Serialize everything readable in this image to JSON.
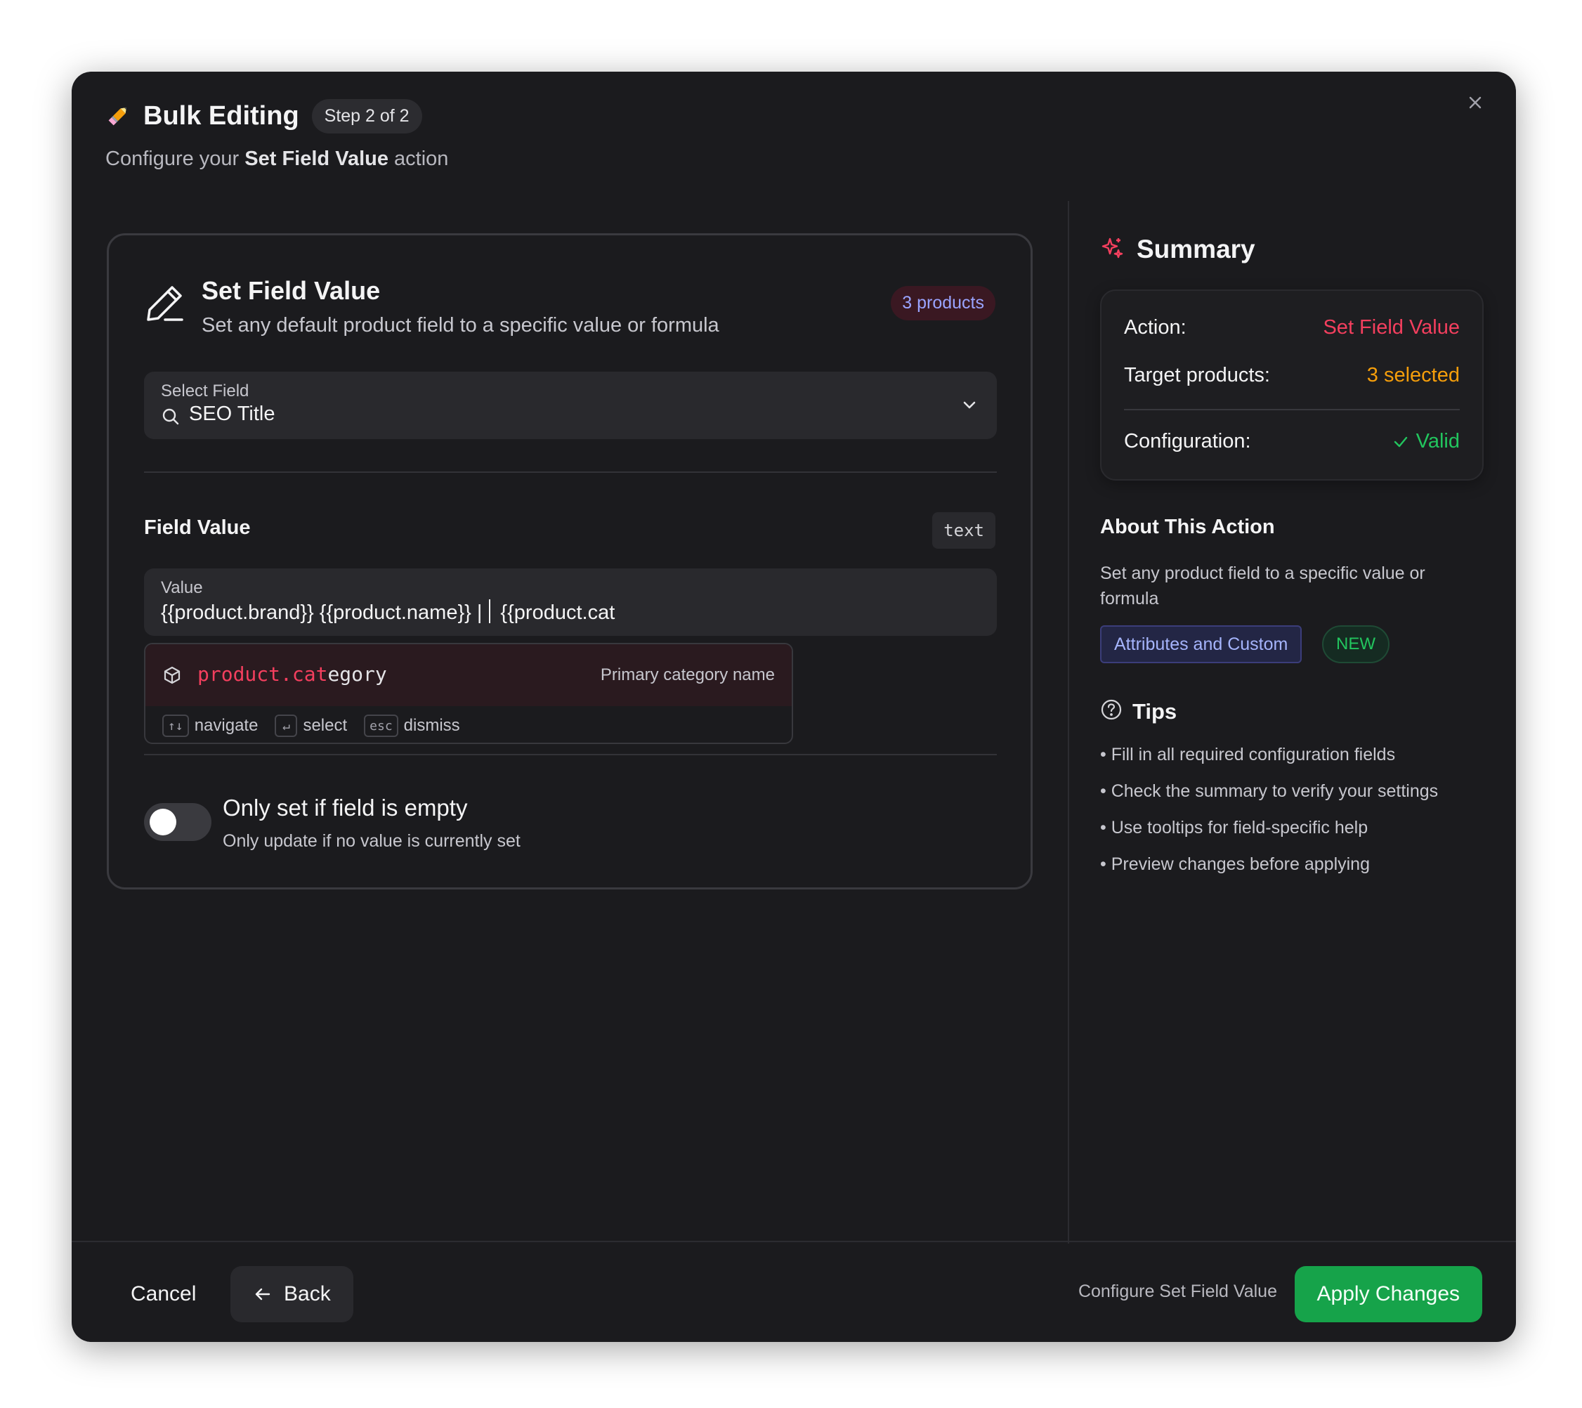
{
  "header": {
    "title": "Bulk Editing",
    "step": "Step 2 of 2",
    "subtitle_prefix": "Configure your ",
    "subtitle_action": "Set Field Value",
    "subtitle_suffix": " action"
  },
  "card": {
    "title": "Set Field Value",
    "description": "Set any default product field to a specific value or formula",
    "badge": "3 products",
    "select": {
      "label": "Select Field",
      "value": "SEO Title"
    },
    "field_value": {
      "label": "Field Value",
      "type": "text",
      "input_label": "Value",
      "input_value": "{{product.brand}} {{product.name}} |",
      "input_after_caret": "{{product.cat"
    },
    "autocomplete": {
      "match": "product.cat",
      "rest": "egory",
      "description": "Primary category name",
      "hints": [
        {
          "key": "↑↓",
          "label": "navigate"
        },
        {
          "key": "↵",
          "label": "select"
        },
        {
          "key": "esc",
          "label": "dismiss"
        }
      ]
    },
    "toggle": {
      "title": "Only set if field is empty",
      "description": "Only update if no value is currently set",
      "enabled": false
    }
  },
  "summary": {
    "title": "Summary",
    "rows": {
      "action_key": "Action:",
      "action_value": "Set Field Value",
      "target_key": "Target products:",
      "target_value": "3 selected",
      "config_key": "Configuration:",
      "config_value": "Valid"
    }
  },
  "about": {
    "title": "About This Action",
    "description": "Set any product field to a specific value or formula",
    "chip_category": "Attributes and Custom",
    "chip_new": "NEW"
  },
  "tips": {
    "title": "Tips",
    "items": [
      "Fill in all required configuration fields",
      "Check the summary to verify your settings",
      "Use tooltips for field-specific help",
      "Preview changes before applying"
    ]
  },
  "footer": {
    "cancel": "Cancel",
    "back": "Back",
    "hint": "Configure Set Field Value",
    "apply": "Apply Changes"
  },
  "colors": {
    "accent_red": "#f43f5e",
    "accent_orange": "#f59e0b",
    "success_green": "#22c55e",
    "apply_button": "#16a34a",
    "indigo_badge": "#9aa4ff",
    "background": "#1b1b1e"
  },
  "icons": [
    "pencil-emoji-icon",
    "close-icon",
    "edit-pen-icon",
    "search-icon",
    "chevron-down-icon",
    "cube-icon",
    "sparkles-icon",
    "check-icon",
    "help-circle-icon",
    "arrow-left-icon"
  ]
}
